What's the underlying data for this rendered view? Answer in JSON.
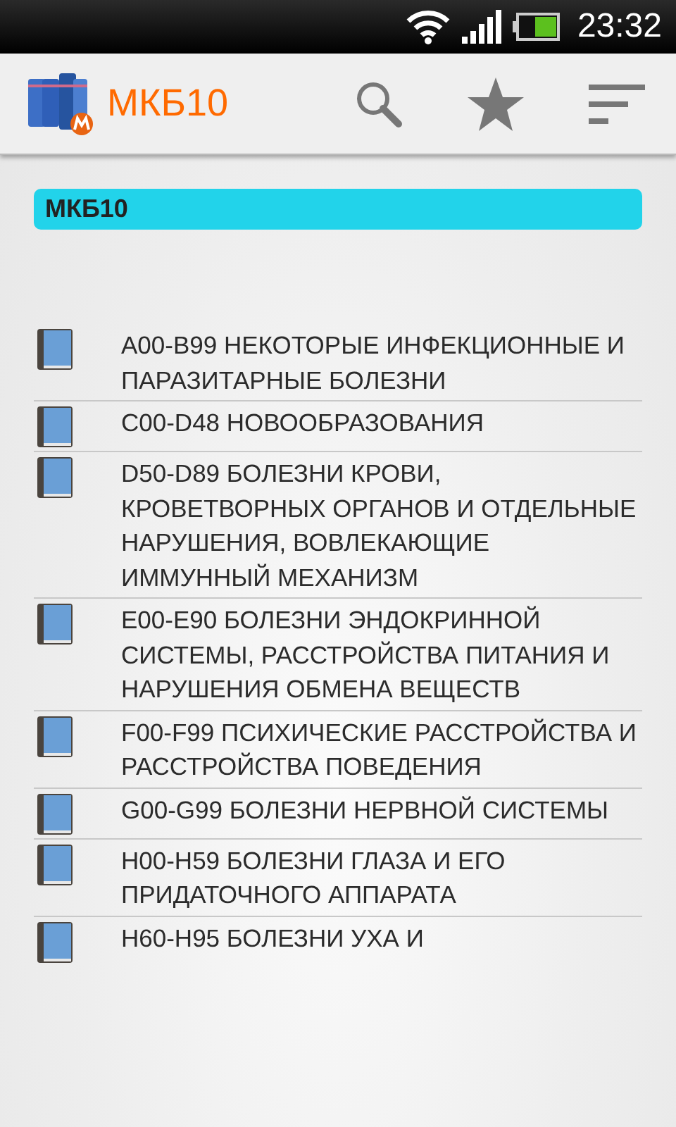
{
  "status_bar": {
    "time": "23:32"
  },
  "app_bar": {
    "title": "МКБ10"
  },
  "header": {
    "title": "МКБ10"
  },
  "items": [
    {
      "text": "A00-B99 НЕКОТОРЫЕ ИНФЕКЦИОННЫЕ И ПАРАЗИТАРНЫЕ БОЛЕЗНИ"
    },
    {
      "text": "C00-D48 НОВООБРАЗОВАНИЯ"
    },
    {
      "text": "D50-D89 БОЛЕЗНИ КРОВИ, КРОВЕТВОРНЫХ ОРГАНОВ И ОТДЕЛЬНЫЕ НАРУШЕНИЯ, ВОВЛЕКАЮЩИЕ ИММУННЫЙ МЕХАНИЗМ"
    },
    {
      "text": "E00-E90 БОЛЕЗНИ ЭНДОКРИННОЙ СИСТЕМЫ, РАССТРОЙСТВА ПИТАНИЯ И НАРУШЕНИЯ ОБМЕНА ВЕЩЕСТВ"
    },
    {
      "text": "F00-F99 ПСИХИЧЕСКИЕ РАССТРОЙСТВА И РАССТРОЙСТВА ПОВЕДЕНИЯ"
    },
    {
      "text": "G00-G99 БОЛЕЗНИ НЕРВНОЙ СИСТЕМЫ"
    },
    {
      "text": "H00-H59 БОЛЕЗНИ ГЛАЗА И ЕГО ПРИДАТОЧНОГО АППАРАТА"
    },
    {
      "text": "H60-H95 БОЛЕЗНИ УХА И"
    }
  ]
}
